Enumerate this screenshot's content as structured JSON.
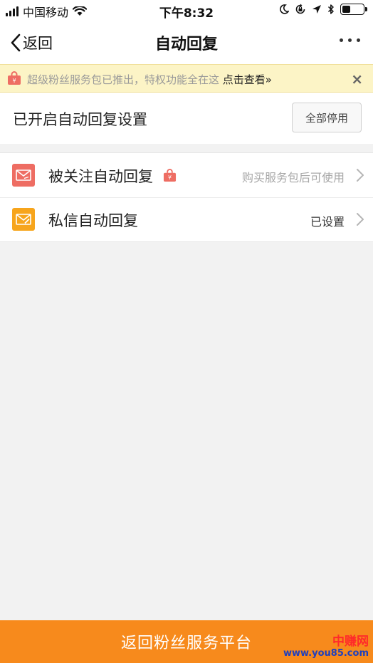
{
  "status_bar": {
    "carrier": "中国移动",
    "time": "下午8:32"
  },
  "nav": {
    "back_label": "返回",
    "title": "自动回复"
  },
  "promo": {
    "text": "超级粉丝服务包已推出，特权功能全在这 ",
    "link": "点击查看»",
    "close": "×"
  },
  "section": {
    "title": "已开启自动回复设置",
    "disable_all": "全部停用"
  },
  "items": [
    {
      "label": "被关注自动回复",
      "status": "购买服务包后可使用",
      "icon": "follow-reply-icon",
      "icon_color": "#ee6d63",
      "locked": true
    },
    {
      "label": "私信自动回复",
      "status": "已设置",
      "icon": "message-reply-icon",
      "icon_color": "#f7a51c",
      "locked": false
    }
  ],
  "bottom": {
    "label": "返回粉丝服务平台"
  },
  "watermark": {
    "top": "中赚网",
    "bottom": "www.you85.com"
  },
  "colors": {
    "accent": "#f78a1c",
    "promo_bg": "#fcf4c6",
    "locked_red": "#ee6d63"
  }
}
